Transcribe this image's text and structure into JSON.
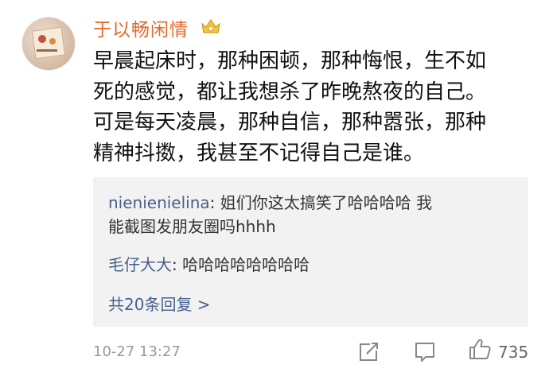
{
  "post": {
    "username": "于以畅闲情",
    "vip_icon": "crown-badge-icon",
    "text": "早晨起床时，那种困顿，那种悔恨，生不如\n死的感觉，都让我想杀了昨晚熬夜的自己。\n可是每天凌晨，那种自信，那种嚣张，那种\n精神抖擞，我甚至不记得自己是谁。",
    "timestamp": "10-27 13:27",
    "like_count": "735"
  },
  "replies": [
    {
      "author": "nienienielina",
      "separator": ": ",
      "text": "姐们你这太搞笑了哈哈哈哈 我\n能截图发朋友圈吗hhhh"
    },
    {
      "author": "毛仔大大",
      "separator": ": ",
      "text": "哈哈哈哈哈哈哈哈"
    }
  ],
  "more_replies_label": "共20条回复 >",
  "colors": {
    "username": "#e06a2b",
    "link": "#47608a",
    "reply_bg": "#f2f2f2",
    "meta": "#999999"
  },
  "icons": {
    "share": "share-icon",
    "comment": "comment-icon",
    "like": "thumbs-up-icon"
  }
}
